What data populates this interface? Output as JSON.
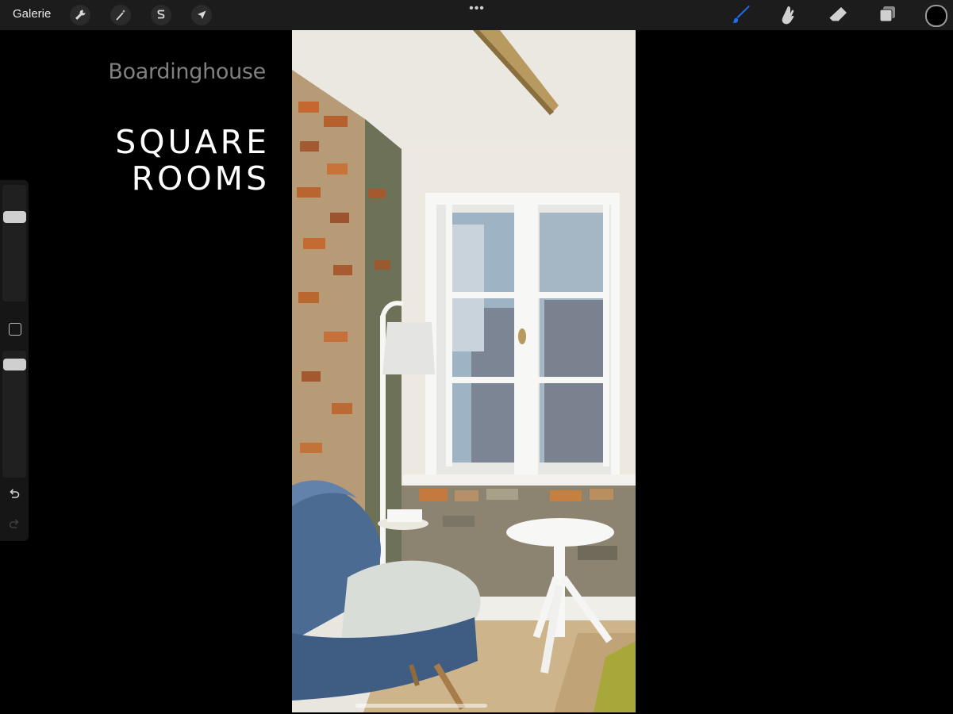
{
  "toolbar": {
    "gallery_label": "Galerie",
    "more_label": "•••",
    "left_tools": [
      {
        "name": "wrench-icon",
        "label": "actions"
      },
      {
        "name": "magic-wand-icon",
        "label": "adjustments"
      },
      {
        "name": "selection-icon",
        "label": "selection"
      },
      {
        "name": "arrow-cursor-icon",
        "label": "transform"
      }
    ],
    "right_tools": [
      {
        "name": "brush-icon",
        "active": true
      },
      {
        "name": "smudge-icon",
        "active": false
      },
      {
        "name": "eraser-icon",
        "active": false
      },
      {
        "name": "layers-icon",
        "active": false
      }
    ],
    "current_color": "#000000",
    "active_tool_color": "#1e6ff0"
  },
  "sidebar": {
    "brush_size_slider_label": "brush size",
    "opacity_slider_label": "opacity",
    "modify_button": "square-icon",
    "undo_icon": "undo-icon",
    "redo_icon": "redo-icon"
  },
  "canvas": {
    "brand": "Boardinghouse",
    "headline_line1": "SQUARE",
    "headline_line2": "ROOMS"
  }
}
